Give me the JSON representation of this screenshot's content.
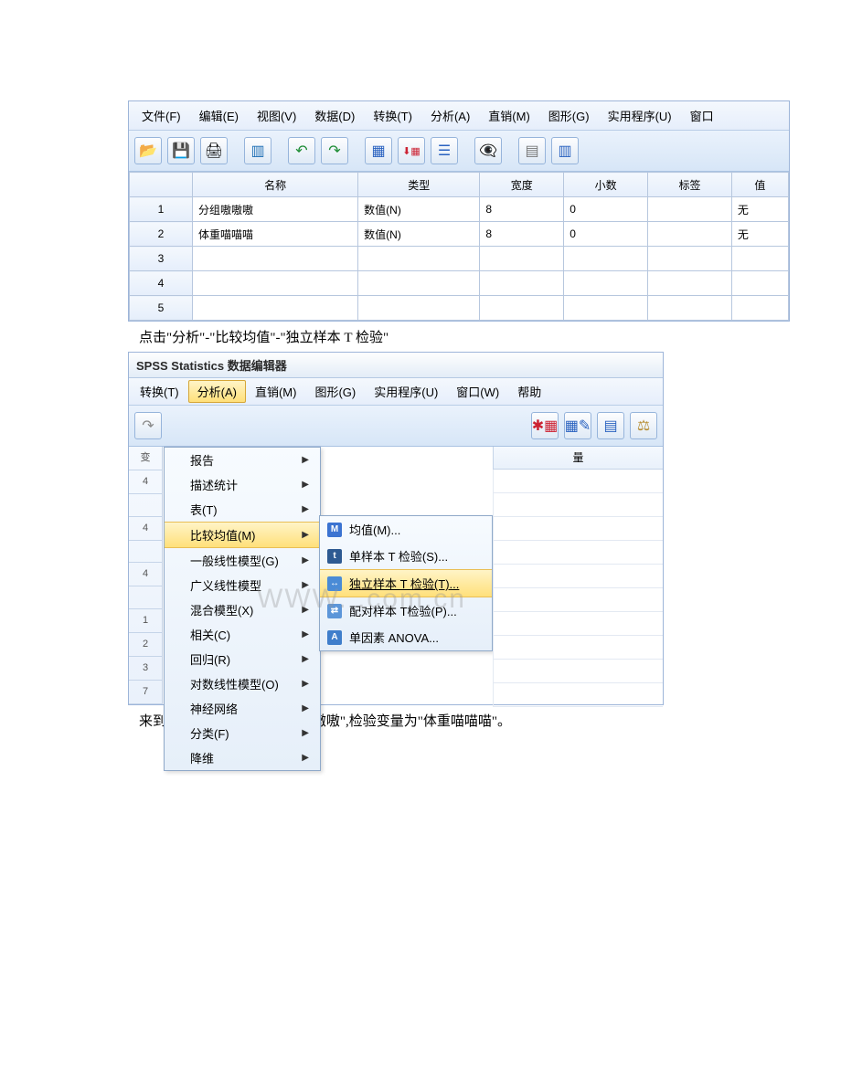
{
  "doc": {
    "caption1": "点击\"分析\"-\"比较均值\"-\"独立样本 T 检验\"",
    "caption2": "来到这里,分组变量为\"分组嗷嗷嗷\",检验变量为\"体重喵喵喵\"。",
    "watermark": "WWW.        .com.cn"
  },
  "shot1": {
    "menu": [
      "文件(F)",
      "编辑(E)",
      "视图(V)",
      "数据(D)",
      "转换(T)",
      "分析(A)",
      "直销(M)",
      "图形(G)",
      "实用程序(U)",
      "窗口"
    ],
    "headers": [
      "",
      "名称",
      "类型",
      "宽度",
      "小数",
      "标签",
      "值"
    ],
    "rows": [
      {
        "n": "1",
        "name": "分组嗷嗷嗷",
        "type": "数值(N)",
        "width": "8",
        "dec": "0",
        "label": "",
        "val": "无"
      },
      {
        "n": "2",
        "name": "体重喵喵喵",
        "type": "数值(N)",
        "width": "8",
        "dec": "0",
        "label": "",
        "val": "无"
      },
      {
        "n": "3",
        "name": "",
        "type": "",
        "width": "",
        "dec": "",
        "label": "",
        "val": ""
      },
      {
        "n": "4",
        "name": "",
        "type": "",
        "width": "",
        "dec": "",
        "label": "",
        "val": ""
      },
      {
        "n": "5",
        "name": "",
        "type": "",
        "width": "",
        "dec": "",
        "label": "",
        "val": ""
      }
    ]
  },
  "shot2": {
    "title": "SPSS Statistics 数据编辑器",
    "menu": [
      {
        "label": "转换(T)",
        "active": false
      },
      {
        "label": "分析(A)",
        "active": true
      },
      {
        "label": "直销(M)",
        "active": false
      },
      {
        "label": "图形(G)",
        "active": false
      },
      {
        "label": "实用程序(U)",
        "active": false
      },
      {
        "label": "窗口(W)",
        "active": false
      },
      {
        "label": "帮助",
        "active": false
      }
    ],
    "analysis_menu": [
      {
        "label": "报告",
        "sub": true
      },
      {
        "label": "描述统计",
        "sub": true
      },
      {
        "label": "表(T)",
        "sub": true
      },
      {
        "label": "比较均值(M)",
        "sub": true,
        "sel": true
      },
      {
        "label": "一般线性模型(G)",
        "sub": true
      },
      {
        "label": "广义线性模型",
        "sub": true
      },
      {
        "label": "混合模型(X)",
        "sub": true
      },
      {
        "label": "相关(C)",
        "sub": true
      },
      {
        "label": "回归(R)",
        "sub": true
      },
      {
        "label": "对数线性模型(O)",
        "sub": true
      },
      {
        "label": "神经网络",
        "sub": true
      },
      {
        "label": "分类(F)",
        "sub": true
      },
      {
        "label": "降维",
        "sub": true
      }
    ],
    "compare_menu": [
      {
        "icon": "M",
        "label": "均值(M)..."
      },
      {
        "icon": "t",
        "label": "单样本 T 检验(S)..."
      },
      {
        "icon": "↔",
        "label": "独立样本 T 检验(T)...",
        "sel": true
      },
      {
        "icon": "⇄",
        "label": "配对样本 T检验(P)..."
      },
      {
        "icon": "A",
        "label": "单因素 ANOVA..."
      }
    ],
    "leftcol_head": "变",
    "right_head": "量",
    "leftrows": [
      "4",
      "",
      "4",
      "",
      "4",
      "",
      "1",
      "2",
      "3",
      "7"
    ]
  }
}
